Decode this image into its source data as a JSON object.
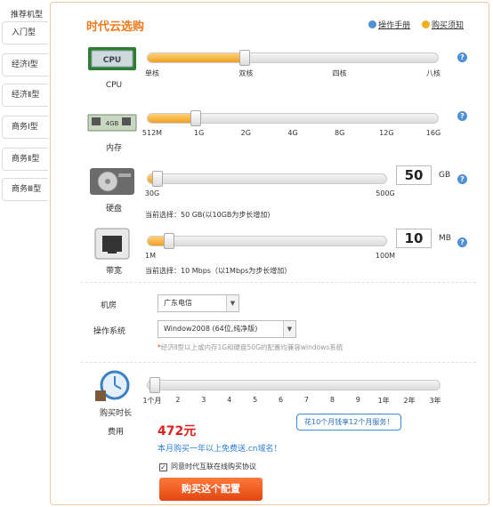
{
  "sidebar": {
    "title": "推荐机型",
    "items": [
      {
        "label": "入门型"
      },
      {
        "label": "经济Ⅰ型"
      },
      {
        "label": "经济Ⅱ型"
      },
      {
        "label": "商务Ⅰ型"
      },
      {
        "label": "商务Ⅱ型"
      },
      {
        "label": "商务Ⅲ型"
      }
    ]
  },
  "header": {
    "title": "时代云选购",
    "manual_link": "操作手册",
    "guide_link": "购买须知"
  },
  "cpu": {
    "label": "CPU",
    "chip_text": "CPU",
    "ticks": [
      "单核",
      "双核",
      "四核",
      "八核"
    ],
    "selected_fraction": 0.333
  },
  "memory": {
    "label": "内存",
    "chip_text": "4GB",
    "ticks": [
      "512M",
      "1G",
      "2G",
      "4G",
      "8G",
      "12G",
      "16G"
    ],
    "selected_fraction": 0.167
  },
  "disk": {
    "label": "硬盘",
    "value": "50",
    "unit": "GB",
    "min_label": "30G",
    "max_label": "500G",
    "current_text": "当前选择：50 GB(以10GB为步长增加)",
    "selected_fraction": 0.04
  },
  "bandwidth": {
    "label": "带宽",
    "value": "10",
    "unit": "MB",
    "min_label": "1M",
    "max_label": "100M",
    "current_text": "当前选择：10 Mbps（以1Mbps为步长增加）",
    "selected_fraction": 0.09
  },
  "datacenter": {
    "label": "机房",
    "value": "广东电信"
  },
  "os": {
    "label": "操作系统",
    "value": "Window2008 (64位,纯净版)",
    "note_star": "*",
    "note": "经济Ⅱ型以上或内存1G和硬盘50G的配置均兼容windows系统"
  },
  "duration": {
    "label": "购买时长",
    "ticks": [
      "1个月",
      "2",
      "3",
      "4",
      "5",
      "6",
      "7",
      "8",
      "9",
      "1年",
      "2年",
      "3年"
    ],
    "selected_fraction": 0.0,
    "tooltip": "花10个月钱享12个月服务！"
  },
  "cost": {
    "label": "费用",
    "price": "472元",
    "promo": "本月购买一年以上免费送.cn域名！",
    "agree_text": "同意时代互联在线购买协议",
    "agree_checked": "✓",
    "buy_button": "购买这个配置"
  },
  "help_mark": "?",
  "colors": {
    "accent_orange": "#f07a1c",
    "price_red": "#e0201c",
    "link_blue": "#2a7fd4",
    "help_blue": "#4f8fd6"
  }
}
